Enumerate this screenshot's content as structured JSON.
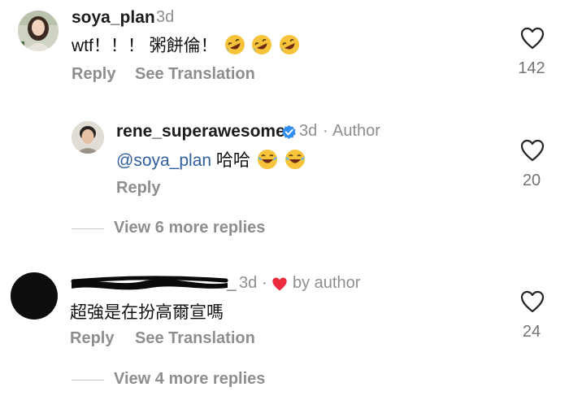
{
  "comments": [
    {
      "username": "soya_plan",
      "time": "3d",
      "text": "wtf！！！ 粥餅倫！",
      "emojis": [
        "rolling-on-floor-laughing",
        "rolling-on-floor-laughing",
        "rolling-on-floor-laughing"
      ],
      "reply_label": "Reply",
      "translation_label": "See Translation",
      "likes": "142"
    },
    {
      "username": "rene_superawesome",
      "time": "3d",
      "separator": "·",
      "author_label": "Author",
      "mention": "@soya_plan",
      "text": " 哈哈",
      "emojis": [
        "tears-of-joy",
        "tears-of-joy"
      ],
      "reply_label": "Reply",
      "likes": "20",
      "verified_color": "#2f8ef0"
    },
    {
      "username_suffix": "_",
      "time": "3d",
      "separator": "·",
      "liked_by_author_label": "by author",
      "text": "超強是在扮高爾宣嗎",
      "reply_label": "Reply",
      "translation_label": "See Translation",
      "likes": "24",
      "heart_color": "#ed2b3e"
    }
  ],
  "view_more": [
    {
      "label": "View 6 more replies"
    },
    {
      "label": "View 4 more replies"
    }
  ]
}
